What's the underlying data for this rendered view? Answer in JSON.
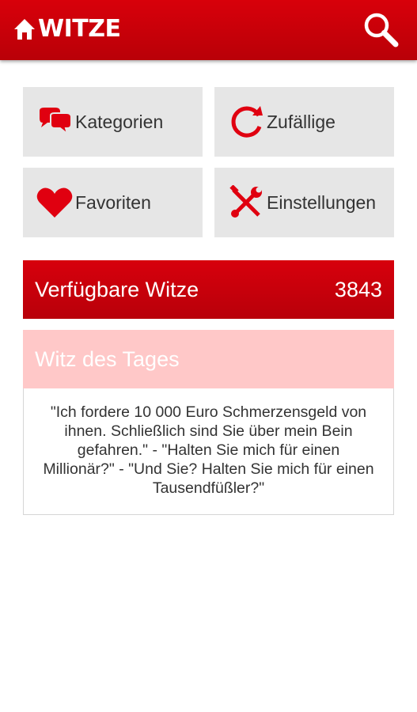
{
  "header": {
    "logo_text": "WITZE",
    "home_icon": "home-icon",
    "search_icon": "search-icon"
  },
  "menu": {
    "items": [
      {
        "label": "Kategorien",
        "icon": "speech-bubbles-icon"
      },
      {
        "label": "Zufällige",
        "icon": "refresh-icon"
      },
      {
        "label": "Favoriten",
        "icon": "heart-icon"
      },
      {
        "label": "Einstellungen",
        "icon": "tools-icon"
      }
    ]
  },
  "stats": {
    "label": "Verfügbare Witze",
    "count": "3843"
  },
  "joke_of_day": {
    "title": "Witz des Tages",
    "text": "\"Ich fordere 10 000 Euro Schmerzensgeld von ihnen. Schließlich sind Sie über mein Bein gefahren.\" - \"Halten Sie mich für einen Millionär?\" - \"Und Sie? Halten Sie mich für einen Tausendfüßler?\""
  },
  "colors": {
    "brand_red": "#c8000a",
    "tile_gray": "#e6e6e6",
    "joke_header_pink": "#ffc8c8",
    "icon_red": "#e00010"
  }
}
